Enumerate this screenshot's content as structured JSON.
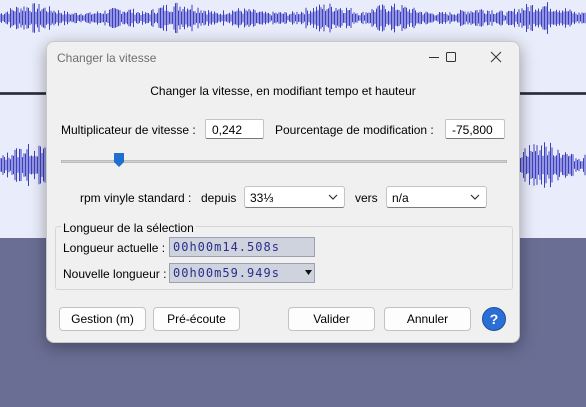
{
  "dialog": {
    "title": "Changer la vitesse",
    "heading": "Changer la vitesse, en modifiant tempo et hauteur",
    "multiplier_label": "Multiplicateur de vitesse :",
    "multiplier_value": "0,242",
    "percent_label": "Pourcentage de modification :",
    "percent_value": "-75,800",
    "slider_level_fraction": 0.13,
    "rpm_label": "rpm vinyle standard :",
    "from_label": "depuis",
    "from_value": "33⅓",
    "to_label": "vers",
    "to_value": "n/a",
    "selection_group_label": "Longueur de la sélection",
    "current_length_label": "Longueur actuelle :",
    "current_length_value": "00h00m14.508s",
    "new_length_label": "Nouvelle longueur :",
    "new_length_value": "00h00m59.949s",
    "buttons": {
      "manage": "Gestion (m)",
      "preview": "Pré-écoute",
      "ok": "Valider",
      "cancel": "Annuler"
    }
  },
  "icons": [
    "minimize-icon",
    "maximize-icon",
    "close-icon",
    "chevron-down-icon",
    "help-icon"
  ],
  "colors": {
    "accent": "#1f6fd1",
    "waveform": "#3d3fc2",
    "track_background": "#e9ecfa",
    "empty_area": "#6a6e94",
    "time_digits": "#2a2e8a"
  }
}
